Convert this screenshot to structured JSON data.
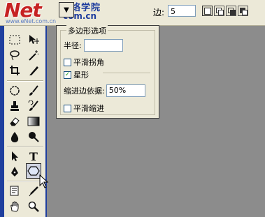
{
  "watermark": {
    "brand": "Net",
    "chinese": "网络学院",
    "url": "com.cn",
    "site": "www.eNet.com.cn"
  },
  "options_bar": {
    "sides_label": "边:",
    "sides_value": "5"
  },
  "polygon_options": {
    "title": "多边形选项",
    "radius_label": "半径:",
    "radius_value": "",
    "smooth_corners_label": "平滑拐角",
    "smooth_corners_checked": false,
    "star_label": "星形",
    "star_checked": true,
    "indent_label": "缩进边依据:",
    "indent_value": "50%",
    "smooth_indents_label": "平滑缩进",
    "smooth_indents_checked": false
  },
  "toolbox": {
    "selected_tool": "polygon-tool",
    "type_tool_glyph": "T"
  }
}
